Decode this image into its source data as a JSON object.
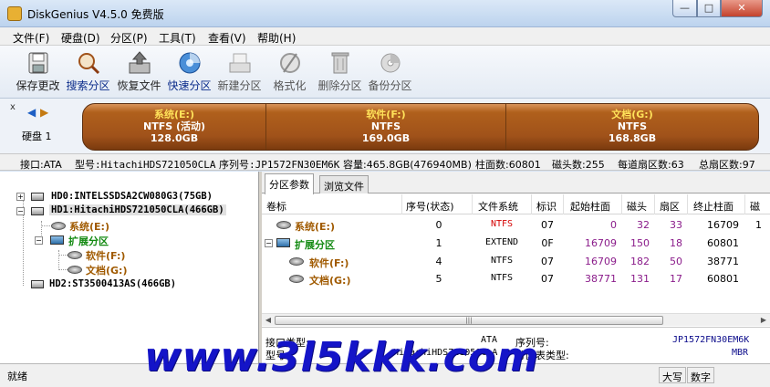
{
  "titlebar": {
    "title": "DiskGenius V4.5.0 免费版",
    "min": "—",
    "max": "□",
    "close": "✕"
  },
  "menu": [
    "文件(F)",
    "硬盘(D)",
    "分区(P)",
    "工具(T)",
    "查看(V)",
    "帮助(H)"
  ],
  "toolbar": [
    {
      "label": "保存更改",
      "icon": "save-icon"
    },
    {
      "label": "搜索分区",
      "icon": "search-icon"
    },
    {
      "label": "恢复文件",
      "icon": "recover-icon"
    },
    {
      "label": "快速分区",
      "icon": "quick-partition-icon"
    },
    {
      "label": "新建分区",
      "icon": "new-partition-icon"
    },
    {
      "label": "格式化",
      "icon": "format-icon"
    },
    {
      "label": "删除分区",
      "icon": "delete-icon"
    },
    {
      "label": "备份分区",
      "icon": "backup-icon"
    }
  ],
  "diskbar": {
    "close": "x",
    "prev": "◀",
    "next": "▶",
    "disk_label": "硬盘 1",
    "segments": [
      {
        "name": "系统(E:)",
        "fs": "NTFS (活动)",
        "size": "128.0GB"
      },
      {
        "name": "软件(F:)",
        "fs": "NTFS",
        "size": "169.0GB"
      },
      {
        "name": "文档(G:)",
        "fs": "NTFS",
        "size": "168.8GB"
      }
    ]
  },
  "disk_info": {
    "interface": "接口:ATA",
    "model": "型号:HitachiHDS721050CLA",
    "serial": "序列号:JP1572FN30EM6K",
    "capacity": "容量:465.8GB(476940MB)",
    "cylinders": "柱面数:60801",
    "heads": "磁头数:255",
    "sectors_per_track": "每道扇区数:63",
    "total_sectors": "总扇区数:97"
  },
  "tree": {
    "hd0": "HD0:INTELSSDSA2CW080G3(75GB)",
    "hd1": "HD1:HitachiHDS721050CLA(466GB)",
    "sys": "系统(E:)",
    "ext": "扩展分区",
    "soft": "软件(F:)",
    "doc": "文档(G:)",
    "hd2": "HD2:ST3500413AS(466GB)"
  },
  "tabs": [
    "分区参数",
    "浏览文件"
  ],
  "table": {
    "headers": [
      "卷标",
      "序号(状态)",
      "文件系统",
      "标识",
      "起始柱面",
      "磁头",
      "扇区",
      "终止柱面",
      "磁"
    ],
    "rows": [
      {
        "label": "系统(E:)",
        "num": "0",
        "fs": "NTFS",
        "id": "07",
        "start": "0",
        "head": "32",
        "sector": "33",
        "end": "16709",
        "extra": "1"
      },
      {
        "label": "扩展分区",
        "num": "1",
        "fs": "EXTEND",
        "id": "0F",
        "start": "16709",
        "head": "150",
        "sector": "18",
        "end": "60801",
        "extra": ""
      },
      {
        "label": "软件(F:)",
        "num": "4",
        "fs": "NTFS",
        "id": "07",
        "start": "16709",
        "head": "182",
        "sector": "50",
        "end": "38771",
        "extra": ""
      },
      {
        "label": "文档(G:)",
        "num": "5",
        "fs": "NTFS",
        "id": "07",
        "start": "38771",
        "head": "131",
        "sector": "17",
        "end": "60801",
        "extra": ""
      }
    ]
  },
  "details": {
    "iface_label": "接口类型:",
    "iface_val": "ATA",
    "serial_label": "序列号:",
    "serial_val": "JP1572FN30EM6K",
    "model_label": "型号:",
    "model_val": "HitachiHDS721050CLA",
    "pt_label": "分区表类型:",
    "pt_val": "MBR"
  },
  "status": {
    "text": "就绪",
    "caps": "大写",
    "num": "数字"
  },
  "watermark": "www.3l5kkk.com"
}
